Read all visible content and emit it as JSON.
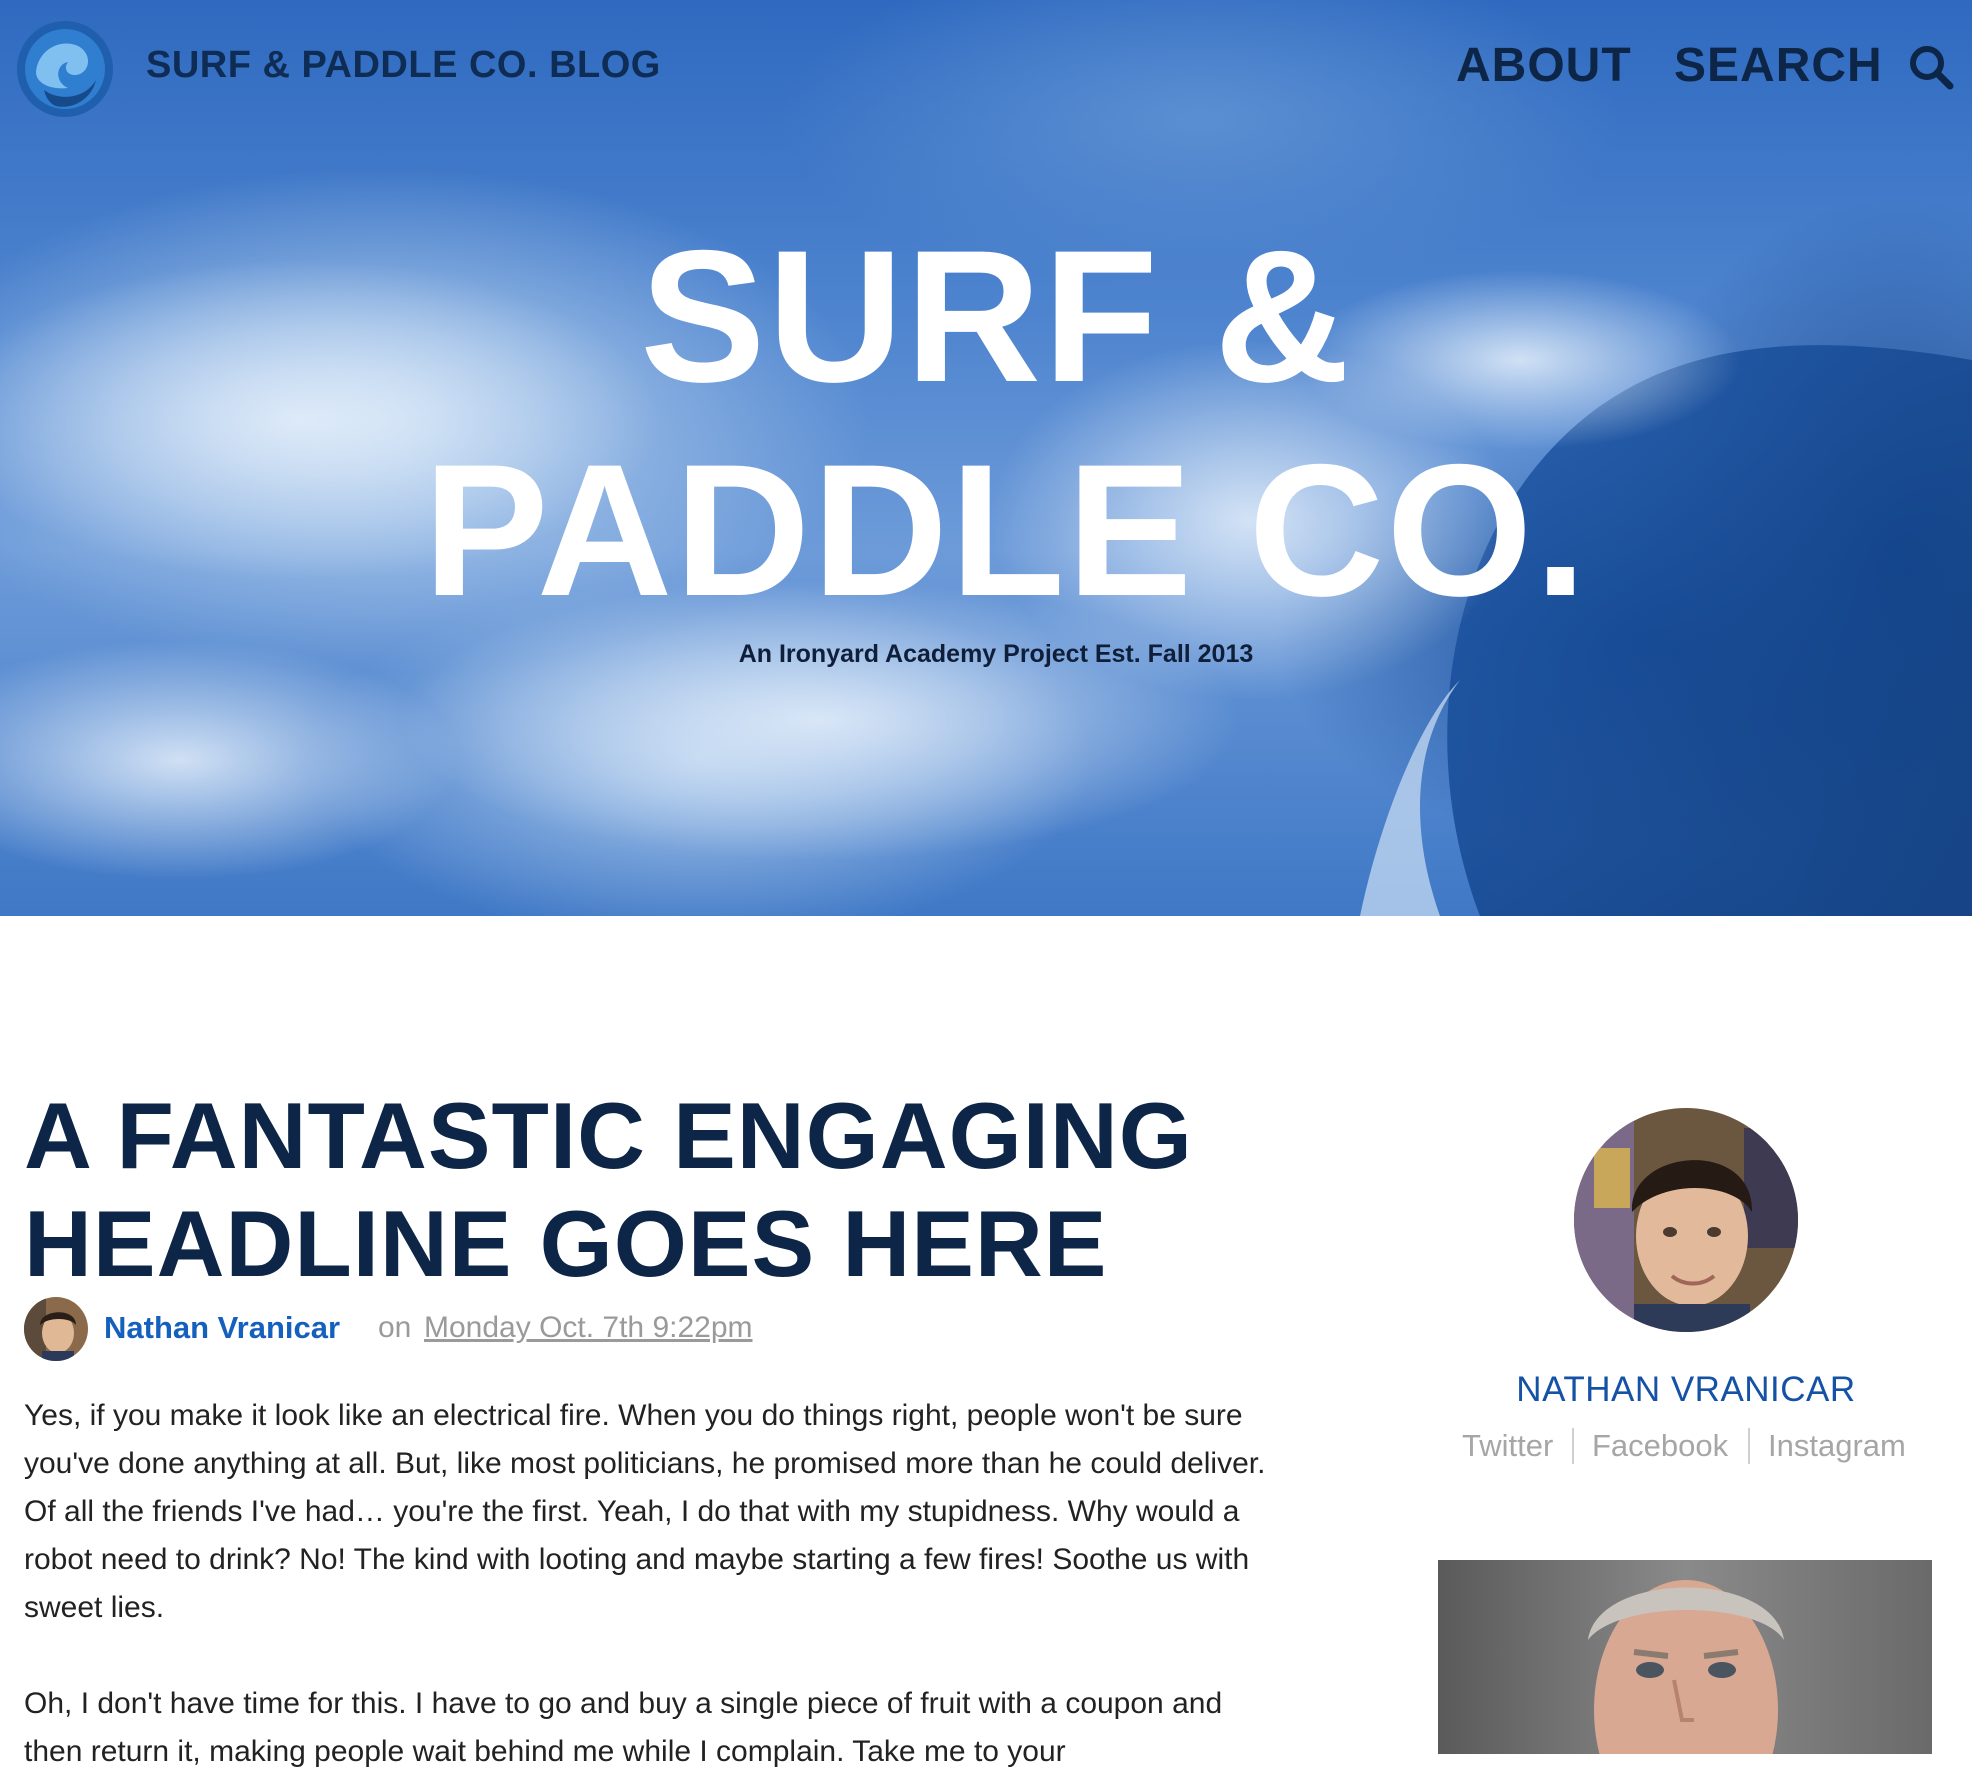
{
  "header": {
    "brand": "SURF & PADDLE CO. BLOG",
    "nav": {
      "about": "ABOUT",
      "search": "SEARCH"
    },
    "logo_icon": "wave-logo-icon",
    "search_icon": "search-icon"
  },
  "hero": {
    "title_line1": "SURF &",
    "title_line2": "PADDLE CO.",
    "subtitle": "An Ironyard Academy Project Est. Fall 2013"
  },
  "article": {
    "headline_line1": "A FANTASTIC ENGAGING",
    "headline_line2": "HEADLINE GOES HERE",
    "author": "Nathan Vranicar",
    "on": "on",
    "date": "Monday Oct. 7th 9:22pm",
    "paragraphs": [
      "Yes, if you make it look like an electrical fire. When you do things right, people won't be sure you've done anything at all. But, like most politicians, he promised more than he could deliver. Of all the friends I've had… you're the first. Yeah, I do that with my stupidness. Why would a robot need to drink? No! The kind with looting and maybe starting a few fires! Soothe us with sweet lies.",
      "Oh, I don't have time for this. I have to go and buy a single piece of fruit with a coupon and then return it, making people wait behind me while I complain. Take me to your"
    ]
  },
  "sidebar": {
    "author_name": "NATHAN VRANICAR",
    "social": {
      "twitter": "Twitter",
      "facebook": "Facebook",
      "instagram": "Instagram"
    }
  },
  "colors": {
    "brand_navy": "#0d2547",
    "link_blue": "#1560bd",
    "muted_gray": "#9a9a9a"
  }
}
